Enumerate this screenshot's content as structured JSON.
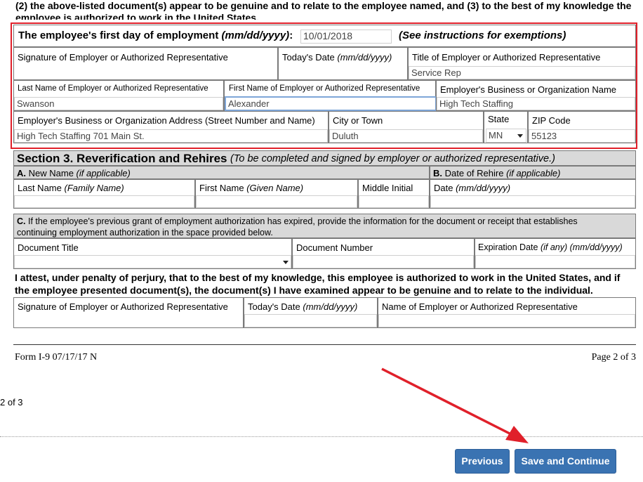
{
  "top_text": {
    "line1": "(2) the above-listed document(s) appear to be genuine and to relate to the employee named, and (3) to the best of my knowledge the",
    "line2": "employee is authorized to work in the United States."
  },
  "section2": {
    "first_day_label": "The employee's first day of employment",
    "first_day_format": "(mm/dd/yyyy)",
    "first_day_colon": ":",
    "first_day_value": "10/01/2018",
    "exemptions_note": "(See instructions for exemptions)",
    "sig_label": "Signature of Employer or Authorized Representative",
    "today_label": "Today's Date",
    "today_format": "(mm/dd/yyyy)",
    "title_label": "Title of Employer or Authorized Representative",
    "title_value": "Service Rep",
    "last_name_label": "Last Name of Employer or Authorized Representative",
    "last_name_value": "Swanson",
    "first_name_label": "First Name of Employer or Authorized Representative",
    "first_name_value": "Alexander",
    "business_name_label": "Employer's Business or Organization Name",
    "business_name_value": "High Tech Staffing",
    "address_label": "Employer's Business or Organization Address (Street Number and Name)",
    "address_value": "High Tech Staffing 701 Main St.",
    "city_label": "City or Town",
    "city_value": "Duluth",
    "state_label": "State",
    "state_value": "MN",
    "zip_label": "ZIP Code",
    "zip_value": "55123"
  },
  "section3": {
    "title": "Section 3. Reverification and Rehires",
    "subtitle": "(To be completed and signed by employer or authorized representative.)",
    "a_letter": "A.",
    "a_label": "New Name",
    "a_note": "(if applicable)",
    "b_letter": "B.",
    "b_label": "Date of Rehire",
    "b_note": "(if applicable)",
    "last_name_label": "Last Name",
    "last_name_note": "(Family Name)",
    "first_name_label": "First Name",
    "first_name_note": "(Given Name)",
    "middle_label": "Middle Initial",
    "date_label": "Date",
    "date_note": "(mm/dd/yyyy)",
    "c_letter": "C.",
    "c_text1": "If the employee's previous grant of employment authorization has expired, provide the information for the document or receipt that establishes",
    "c_text2": "continuing employment authorization in the space provided below.",
    "doc_title_label": "Document Title",
    "doc_number_label": "Document Number",
    "exp_label": "Expiration Date",
    "exp_note": "(if any) (mm/dd/yyyy)",
    "attest1": "I attest, under penalty of perjury, that to the best of my knowledge, this employee is authorized to work in the United States, and if",
    "attest2": "the employee presented document(s), the document(s) I have examined appear to be genuine and to relate to the individual.",
    "sig_label": "Signature of Employer or Authorized Representative",
    "today_label": "Today's Date",
    "today_note": "(mm/dd/yyyy)",
    "name_label": "Name of Employer or Authorized Representative"
  },
  "footer": {
    "form_id": "Form I-9  07/17/17  N",
    "page": "Page 2 of 3",
    "page_fragment": "2 of 3"
  },
  "buttons": {
    "previous": "Previous",
    "save_continue": "Save and Continue"
  },
  "colors": {
    "highlight_border": "#e0202a",
    "button_bg": "#3a73b2",
    "section_header_bg": "#d9d9d9"
  }
}
